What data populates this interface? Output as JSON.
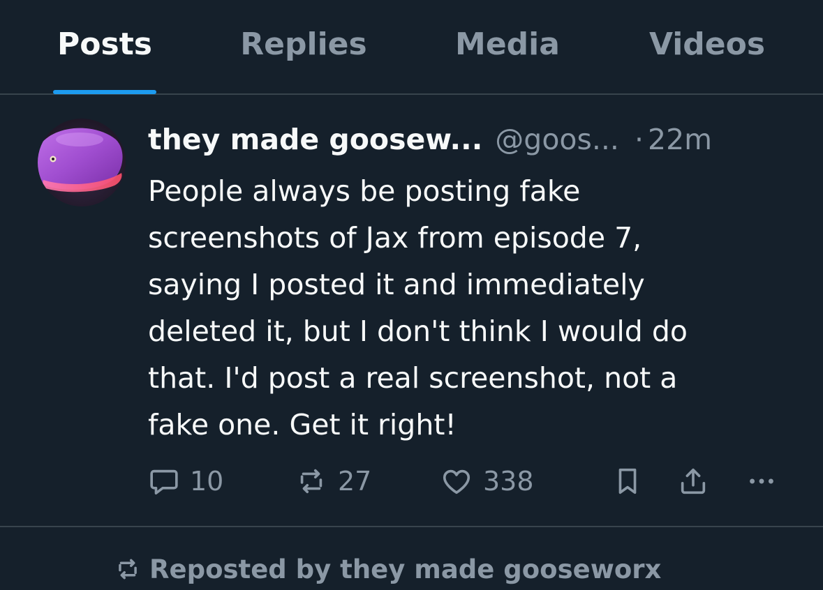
{
  "tabs": [
    {
      "label": "Posts",
      "active": true
    },
    {
      "label": "Replies",
      "active": false
    },
    {
      "label": "Media",
      "active": false
    },
    {
      "label": "Videos",
      "active": false
    }
  ],
  "post": {
    "display_name": "they made goosew...",
    "handle": "@goos...",
    "separator": "·",
    "time": "22m",
    "text": "People always be posting fake\nscreenshots of Jax from episode 7,\nsaying I posted it and immediately\ndeleted it, but I don't think I would do\nthat. I'd post a real screenshot, not a\nfake one. Get it right!",
    "actions": {
      "replies": "10",
      "reposts": "27",
      "likes": "338"
    }
  },
  "repost_banner": {
    "text": "Reposted by they made gooseworx"
  },
  "icons": {
    "reply": "speech-bubble-icon",
    "repost": "repost-arrows-icon",
    "like": "heart-icon",
    "bookmark": "bookmark-icon",
    "share": "share-upload-icon",
    "more": "more-dots-icon"
  },
  "colors": {
    "background": "#15202b",
    "divider": "#38444d",
    "primary_text": "#f7f9f9",
    "secondary_text": "#8b98a5",
    "accent": "#1d9bf0"
  }
}
